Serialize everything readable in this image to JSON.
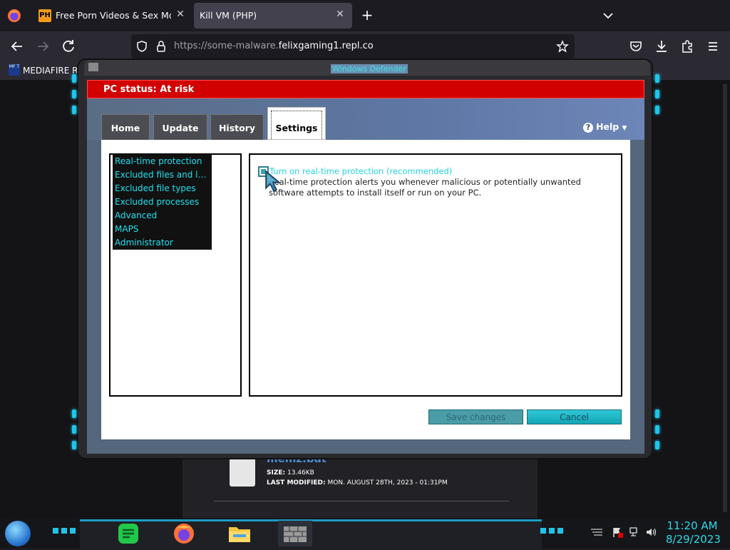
{
  "browser": {
    "tabs": [
      {
        "favicon": "PH",
        "title": "Free Porn Videos & Sex Movies",
        "active": false
      },
      {
        "title": "Kill VM (PHP)",
        "active": true
      }
    ],
    "url": {
      "prefix": "https://some-malware.",
      "domain": "felixgaming1.repl.co"
    },
    "bookmarks": [
      {
        "icon": "MF T",
        "label": "MEDIAFIRE R"
      }
    ]
  },
  "defender": {
    "title": "Windows Defender",
    "status": "PC status: At risk",
    "tabs": [
      "Home",
      "Update",
      "History",
      "Settings"
    ],
    "active_tab": "Settings",
    "help_label": "Help",
    "help_arrow": "▼",
    "settings_menu": [
      "Real-time protection",
      "Excluded files and locat...",
      "Excluded file types",
      "Excluded processes",
      "Advanced",
      "MAPS",
      "Administrator"
    ],
    "option_label": "Turn on real-time protection (recommended)",
    "option_description": "Real-time protection alerts you whenever malicious or potentially unwanted software attempts to install itself or run on your PC.",
    "save_label": "Save changes",
    "cancel_label": "Cancel"
  },
  "download": {
    "filename": "memz.bat",
    "size_label": "SIZE:",
    "size_value": "13.46KB",
    "modified_label": "LAST MODIFIED:",
    "modified_value": "MON. AUGUST 28TH, 2023 - 01:31PM"
  },
  "taskbar": {
    "time": "11:20 AM",
    "date": "8/29/2023"
  },
  "colors": {
    "status_red": "#d20000",
    "accent_cyan": "#21e0f0",
    "browser_bg": "#1c1b22"
  }
}
